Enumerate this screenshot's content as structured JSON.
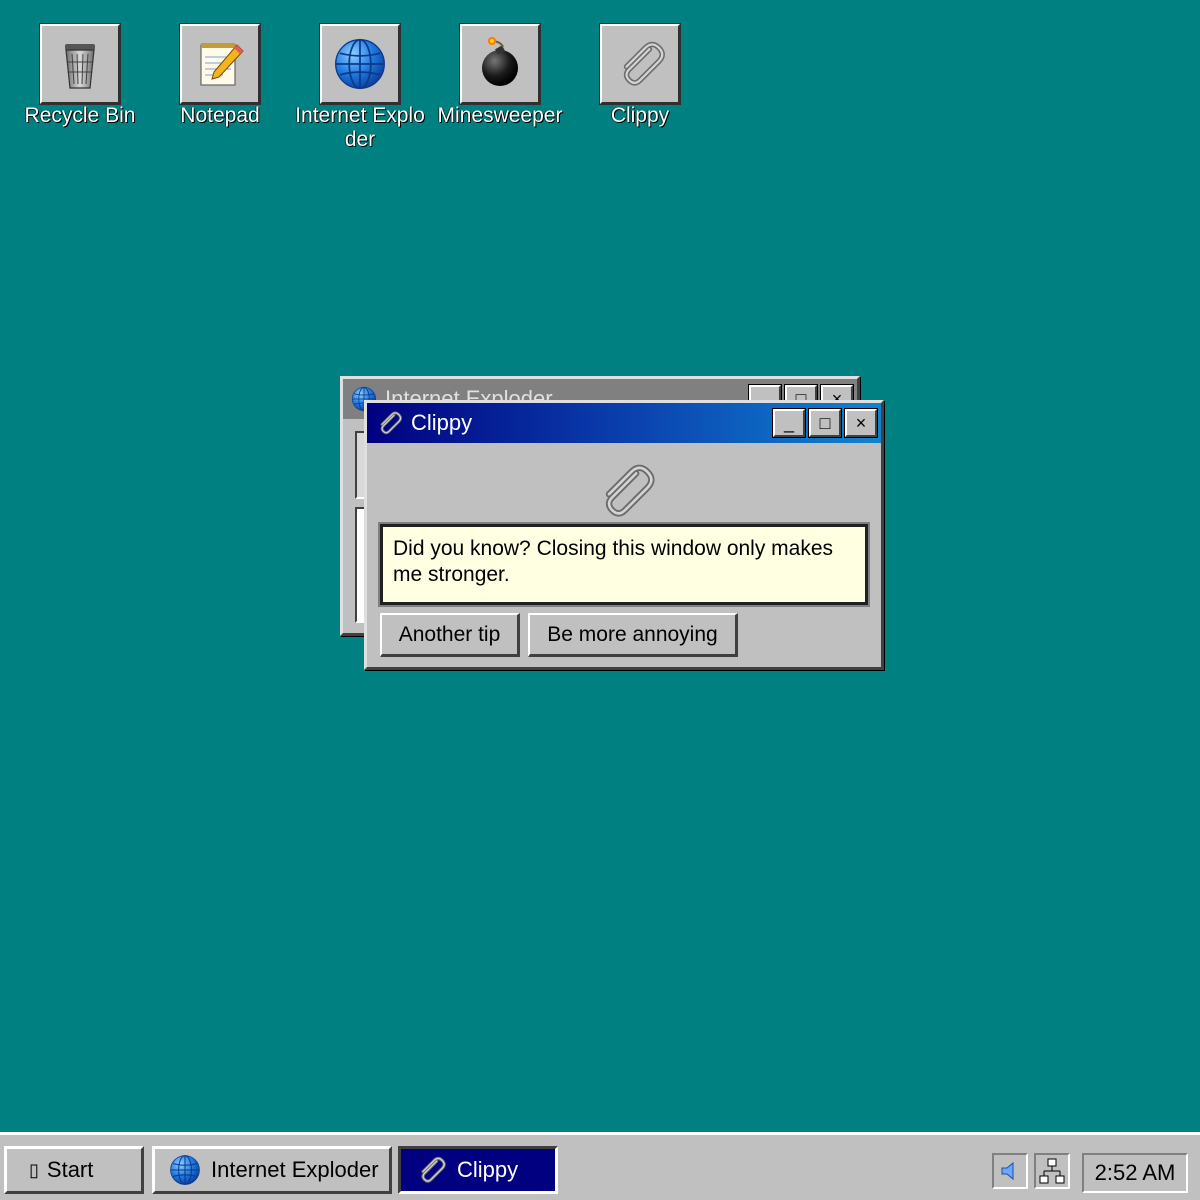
{
  "desktop": {
    "icons": [
      {
        "label": "Recycle Bin",
        "icon": "recycle-bin-icon"
      },
      {
        "label": "Notepad",
        "icon": "notepad-icon"
      },
      {
        "label": "Internet Exploder",
        "icon": "globe-icon"
      },
      {
        "label": "Minesweeper",
        "icon": "bomb-icon"
      },
      {
        "label": "Clippy",
        "icon": "paperclip-icon"
      }
    ]
  },
  "windows": {
    "background": {
      "title": "Internet Exploder",
      "icon": "globe-icon",
      "controls": [
        "_",
        "□",
        "×"
      ]
    },
    "clippy": {
      "title": "Clippy",
      "icon": "paperclip-icon",
      "controls": [
        "_",
        "□",
        "×"
      ],
      "message": "Did you know? Closing this window only makes me stronger.",
      "buttons": {
        "another_tip": "Another tip",
        "more_annoying": "Be more annoying"
      }
    }
  },
  "taskbar": {
    "start_label": "Start",
    "start_glyph": "▯",
    "tasks": [
      {
        "label": "Internet Exploder",
        "icon": "globe-icon",
        "active": false
      },
      {
        "label": "Clippy",
        "icon": "paperclip-icon",
        "active": true
      }
    ],
    "tray": {
      "icons": [
        "speaker-icon",
        "network-icon"
      ],
      "clock": "2:52 AM"
    }
  },
  "colors": {
    "desktop": "#008080",
    "title_active_start": "#000080",
    "title_active_end": "#1084d0",
    "title_inactive": "#808080",
    "face": "#c0c0c0",
    "tooltip": "#ffffe1"
  }
}
